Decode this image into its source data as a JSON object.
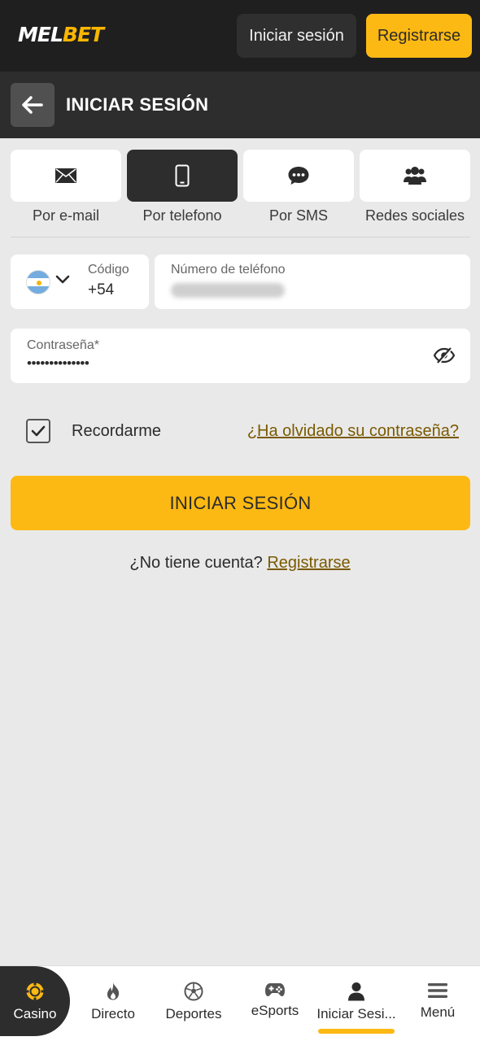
{
  "header": {
    "logo_left": "MEL",
    "logo_right": "BET",
    "login_button": "Iniciar sesión",
    "register_button": "Registrarse"
  },
  "page": {
    "title": "INICIAR SESIÓN"
  },
  "tabs": [
    {
      "label": "Por e-mail",
      "icon": "envelope-icon",
      "active": false
    },
    {
      "label": "Por telefono",
      "icon": "phone-icon",
      "active": true
    },
    {
      "label": "Por SMS",
      "icon": "chat-bubble-icon",
      "active": false
    },
    {
      "label": "Redes sociales",
      "icon": "people-icon",
      "active": false
    }
  ],
  "form": {
    "country_code_label": "Código",
    "country_code_value": "+54",
    "country_flag": "argentina-flag-icon",
    "phone_label": "Número de teléfono",
    "password_label": "Contraseña*",
    "password_value": "••••••••••••••",
    "remember_label": "Recordarme",
    "remember_checked": true,
    "forgot_link": "¿Ha olvidado su contraseña?",
    "submit_label": "INICIAR SESIÓN",
    "no_account_text": "¿No tiene cuenta?",
    "register_link": "Registrarse"
  },
  "bottom_nav": [
    {
      "label": "Casino",
      "icon": "casino-chip-icon",
      "active": false
    },
    {
      "label": "Directo",
      "icon": "flame-icon",
      "active": false
    },
    {
      "label": "Deportes",
      "icon": "soccer-ball-icon",
      "active": false
    },
    {
      "label": "eSports",
      "icon": "gamepad-icon",
      "active": false
    },
    {
      "label": "Iniciar Sesi...",
      "icon": "user-icon",
      "active": true
    },
    {
      "label": "Menú",
      "icon": "hamburger-menu-icon",
      "active": false
    }
  ],
  "colors": {
    "accent": "#fdb913",
    "dark": "#1f1f1f",
    "link": "#7a5a00"
  }
}
